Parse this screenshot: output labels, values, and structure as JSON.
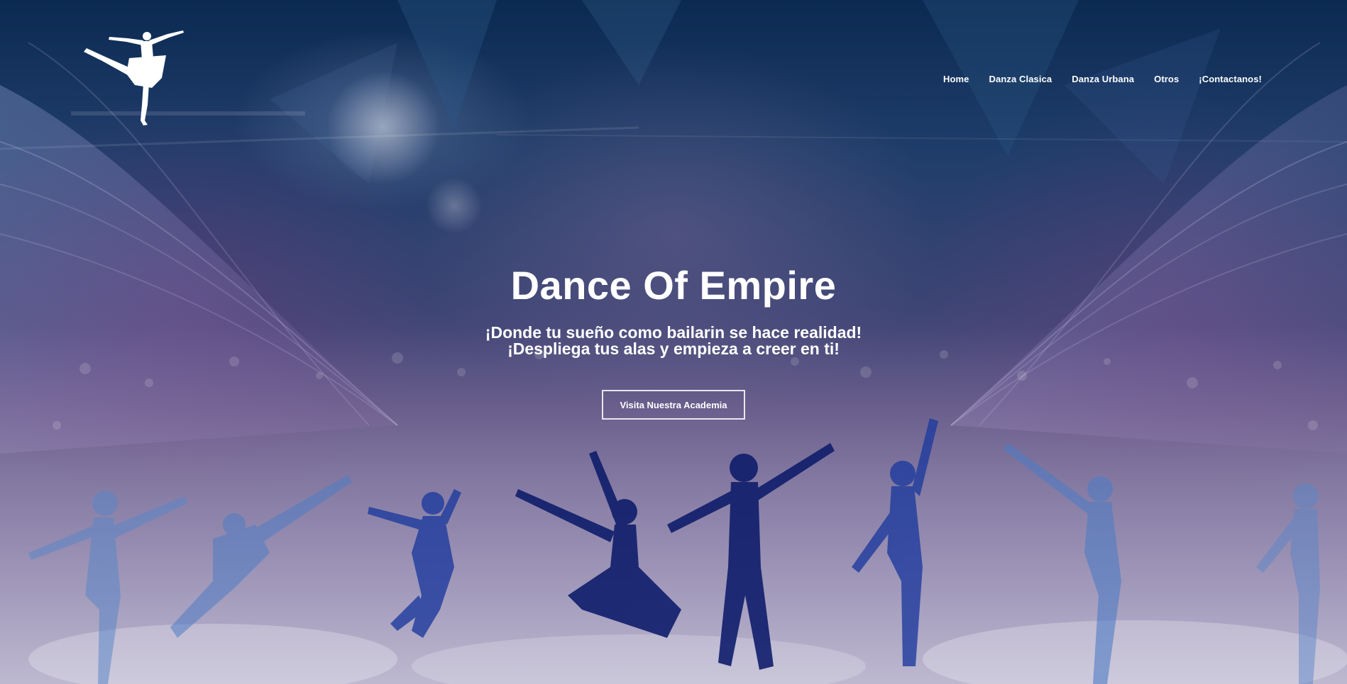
{
  "site": {
    "logo_icon": "ballerina-icon"
  },
  "nav": {
    "items": [
      {
        "label": "Home"
      },
      {
        "label": "Danza Clasica"
      },
      {
        "label": "Danza Urbana"
      },
      {
        "label": "Otros"
      },
      {
        "label": "¡Contactanos!"
      }
    ]
  },
  "hero": {
    "title": "Dance Of Empire",
    "subtitle_line1": "¡Donde tu sueño como bailarin se hace realidad!",
    "subtitle_line2": "¡Despliega tus alas y empieza a creer en ti!",
    "cta_label": "Visita Nuestra Academia"
  },
  "colors": {
    "text": "#ffffff",
    "bg_top": "#0b2a52",
    "bg_bottom": "#8c88ad",
    "silhouette_dark": "#0f1d6b",
    "silhouette_light": "#3f63b8"
  }
}
